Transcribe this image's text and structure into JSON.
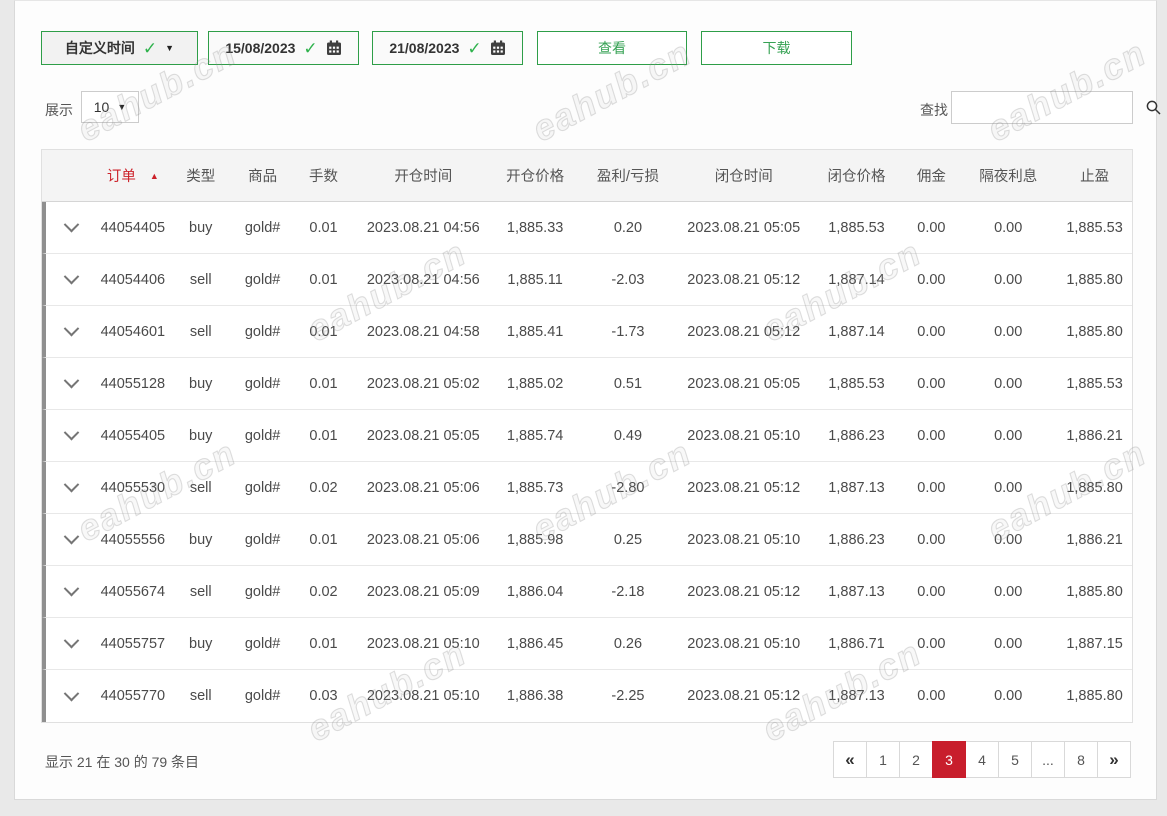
{
  "watermark": {
    "text": "eahub.cn"
  },
  "toolbar": {
    "range_selector_label": "自定义时间",
    "date_from": "15/08/2023",
    "date_to": "21/08/2023",
    "view_button": "查看",
    "download_button": "下载"
  },
  "display_controls": {
    "show_label": "展示",
    "page_size": "10",
    "search_label": "查找",
    "search_value": ""
  },
  "icons": {
    "check": "✓",
    "caret_down": "▼",
    "sort_asc": "▲"
  },
  "table": {
    "columns": [
      "订单",
      "类型",
      "商品",
      "手数",
      "开仓时间",
      "开仓价格",
      "盈利/亏损",
      "闭仓时间",
      "闭仓价格",
      "佣金",
      "隔夜利息",
      "止盈"
    ],
    "sort": {
      "column": "订单",
      "direction": "asc"
    },
    "rows": [
      {
        "order": "44054405",
        "type": "buy",
        "product": "gold#",
        "lots": "0.01",
        "open_time": "2023.08.21 04:56",
        "open_price": "1,885.33",
        "profit_loss": "0.20",
        "close_time": "2023.08.21 05:05",
        "close_price": "1,885.53",
        "commission": "0.00",
        "swap": "0.00",
        "take_profit": "1,885.53"
      },
      {
        "order": "44054406",
        "type": "sell",
        "product": "gold#",
        "lots": "0.01",
        "open_time": "2023.08.21 04:56",
        "open_price": "1,885.11",
        "profit_loss": "-2.03",
        "close_time": "2023.08.21 05:12",
        "close_price": "1,887.14",
        "commission": "0.00",
        "swap": "0.00",
        "take_profit": "1,885.80"
      },
      {
        "order": "44054601",
        "type": "sell",
        "product": "gold#",
        "lots": "0.01",
        "open_time": "2023.08.21 04:58",
        "open_price": "1,885.41",
        "profit_loss": "-1.73",
        "close_time": "2023.08.21 05:12",
        "close_price": "1,887.14",
        "commission": "0.00",
        "swap": "0.00",
        "take_profit": "1,885.80"
      },
      {
        "order": "44055128",
        "type": "buy",
        "product": "gold#",
        "lots": "0.01",
        "open_time": "2023.08.21 05:02",
        "open_price": "1,885.02",
        "profit_loss": "0.51",
        "close_time": "2023.08.21 05:05",
        "close_price": "1,885.53",
        "commission": "0.00",
        "swap": "0.00",
        "take_profit": "1,885.53"
      },
      {
        "order": "44055405",
        "type": "buy",
        "product": "gold#",
        "lots": "0.01",
        "open_time": "2023.08.21 05:05",
        "open_price": "1,885.74",
        "profit_loss": "0.49",
        "close_time": "2023.08.21 05:10",
        "close_price": "1,886.23",
        "commission": "0.00",
        "swap": "0.00",
        "take_profit": "1,886.21"
      },
      {
        "order": "44055530",
        "type": "sell",
        "product": "gold#",
        "lots": "0.02",
        "open_time": "2023.08.21 05:06",
        "open_price": "1,885.73",
        "profit_loss": "-2.80",
        "close_time": "2023.08.21 05:12",
        "close_price": "1,887.13",
        "commission": "0.00",
        "swap": "0.00",
        "take_profit": "1,885.80"
      },
      {
        "order": "44055556",
        "type": "buy",
        "product": "gold#",
        "lots": "0.01",
        "open_time": "2023.08.21 05:06",
        "open_price": "1,885.98",
        "profit_loss": "0.25",
        "close_time": "2023.08.21 05:10",
        "close_price": "1,886.23",
        "commission": "0.00",
        "swap": "0.00",
        "take_profit": "1,886.21"
      },
      {
        "order": "44055674",
        "type": "sell",
        "product": "gold#",
        "lots": "0.02",
        "open_time": "2023.08.21 05:09",
        "open_price": "1,886.04",
        "profit_loss": "-2.18",
        "close_time": "2023.08.21 05:12",
        "close_price": "1,887.13",
        "commission": "0.00",
        "swap": "0.00",
        "take_profit": "1,885.80"
      },
      {
        "order": "44055757",
        "type": "buy",
        "product": "gold#",
        "lots": "0.01",
        "open_time": "2023.08.21 05:10",
        "open_price": "1,886.45",
        "profit_loss": "0.26",
        "close_time": "2023.08.21 05:10",
        "close_price": "1,886.71",
        "commission": "0.00",
        "swap": "0.00",
        "take_profit": "1,887.15"
      },
      {
        "order": "44055770",
        "type": "sell",
        "product": "gold#",
        "lots": "0.03",
        "open_time": "2023.08.21 05:10",
        "open_price": "1,886.38",
        "profit_loss": "-2.25",
        "close_time": "2023.08.21 05:12",
        "close_price": "1,887.13",
        "commission": "0.00",
        "swap": "0.00",
        "take_profit": "1,885.80"
      }
    ]
  },
  "footer": {
    "summary": "显示 21 在 30 的 79 条目",
    "pagination": {
      "first": "«",
      "last": "»",
      "pages": [
        "1",
        "2",
        "3",
        "4",
        "5",
        "...",
        "8"
      ],
      "active": "3"
    }
  },
  "colors": {
    "accent_green": "#2e9e48",
    "sort_red": "#cc2129",
    "active_page_red": "#c81e2c"
  }
}
